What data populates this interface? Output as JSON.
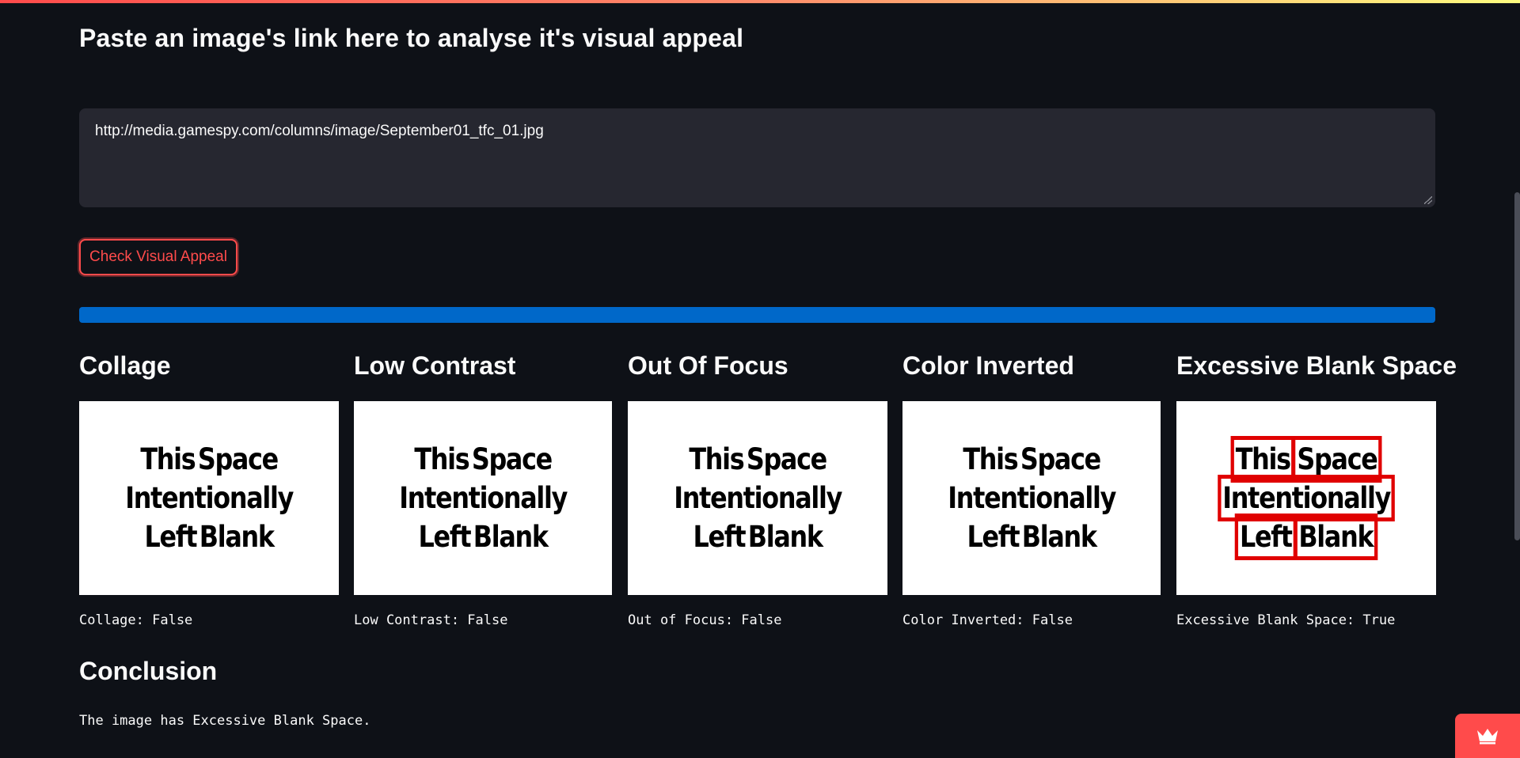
{
  "header": {
    "title": "Paste an image's link here to analyse it's visual appeal"
  },
  "url_input": {
    "value": "http://media.gamespy.com/columns/image/September01_tfc_01.jpg"
  },
  "check_button": {
    "label": "Check Visual Appeal"
  },
  "progress": {
    "fraction": 1.0,
    "color": "#0068c9"
  },
  "checks": [
    {
      "title": "Collage",
      "result": "Collage: False",
      "highlighted": false
    },
    {
      "title": "Low Contrast",
      "result": "Low Contrast: False",
      "highlighted": false
    },
    {
      "title": "Out Of Focus",
      "result": "Out of Focus: False",
      "highlighted": false
    },
    {
      "title": "Color Inverted",
      "result": "Color Inverted: False",
      "highlighted": false
    },
    {
      "title": "Excessive Blank Space",
      "result": "Excessive Blank Space: True",
      "highlighted": true
    }
  ],
  "thumbnail_text": {
    "line1": [
      "This",
      "Space"
    ],
    "line2": [
      "Intentionally"
    ],
    "line3": [
      "Left",
      "Blank"
    ]
  },
  "conclusion": {
    "heading": "Conclusion",
    "text": "The image has Excessive Blank Space."
  },
  "colors": {
    "accent": "#ff4b4b",
    "background": "#0e1117",
    "input_bg": "#262730",
    "highlight_box": "#e00000"
  },
  "icons": {
    "badge": "crown-icon"
  }
}
